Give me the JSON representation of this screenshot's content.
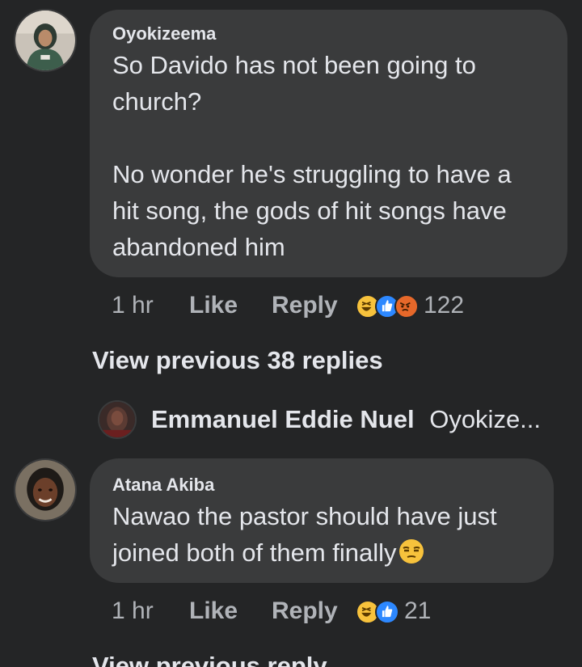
{
  "comments": [
    {
      "author": "Oyokizeema",
      "text_lines": [
        "So Davido has not been going to",
        "church?",
        "",
        "No wonder he's struggling to have a",
        "hit song, the gods of hit songs have",
        "abandoned him"
      ],
      "time": "1 hr",
      "like_label": "Like",
      "reply_label": "Reply",
      "reaction_icons": [
        "haha-reaction-icon",
        "like-reaction-icon",
        "angry-reaction-icon"
      ],
      "reaction_count": "122"
    },
    {
      "author": "Atana Akiba",
      "text_lines": [
        "Nawao the pastor should have just",
        "joined both of them finally"
      ],
      "trailing_emoji": "unamused-face-emoji",
      "time": "1 hr",
      "like_label": "Like",
      "reply_label": "Reply",
      "reaction_icons": [
        "haha-reaction-icon",
        "like-reaction-icon"
      ],
      "reaction_count": "21"
    }
  ],
  "view_previous_replies_1": "View previous 38 replies",
  "collapsed_reply": {
    "author": "Emmanuel Eddie Nuel",
    "preview": "Oyokize..."
  },
  "view_previous_replies_2": "View previous reply",
  "colors": {
    "background": "#242526",
    "bubble": "#3a3b3c",
    "text_primary": "#e4e6eb",
    "text_secondary": "#b0b3b8",
    "haha": "#f7c23c",
    "like": "#2d88ff",
    "angry": "#e6682a"
  }
}
